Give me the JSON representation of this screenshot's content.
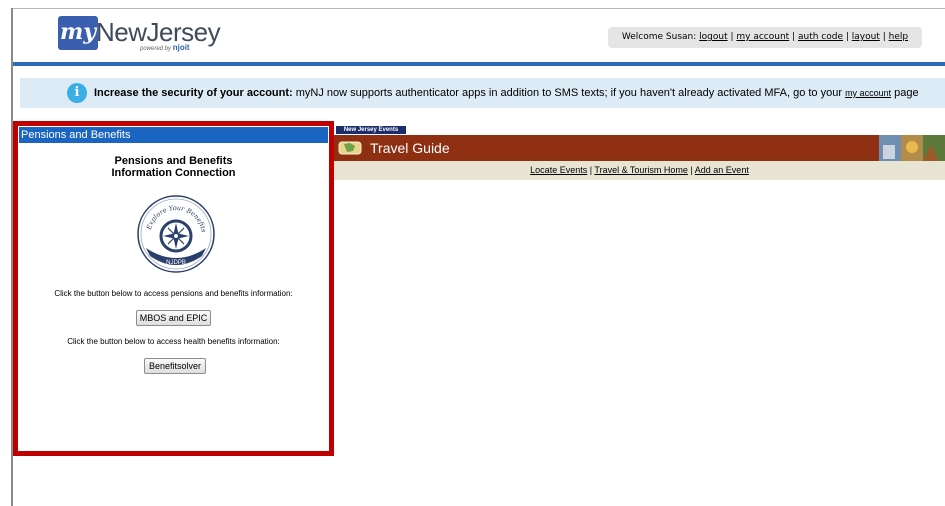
{
  "header": {
    "logo_my": "my",
    "logo_name": "NewJersey",
    "logo_powered": "powered by",
    "logo_powered_brand": "njoit",
    "welcome_text": "Welcome Susan:",
    "links": [
      "logout",
      "my account",
      "auth code",
      "layout",
      "help"
    ]
  },
  "alert": {
    "icon": "info-icon",
    "bold_text": "Increase the security of your account:",
    "text": " myNJ now supports authenticator apps in addition to SMS texts; if you haven't already activated MFA, go to your ",
    "link": "my account",
    "suffix": " page"
  },
  "pensions_panel": {
    "header": "Pensions and Benefits",
    "title_line1": "Pensions and Benefits",
    "title_line2": "Information Connection",
    "badge_top": "Explore Your Benefits",
    "badge_bottom": "NJDPB",
    "instruction1": "Click the button below to access pensions and benefits information:",
    "button1": "MBOS and EPIC",
    "instruction2": "Click the button below to access health benefits information:",
    "button2": "Benefitsolver"
  },
  "travel": {
    "tab": "New Jersey Events",
    "title": "Travel Guide",
    "links": [
      "Locate Events",
      "Travel & Tourism Home",
      "Add an Event"
    ]
  },
  "colors": {
    "panel_border": "#c00000",
    "panel_header": "#1a64c2",
    "travel_bar": "#8e2f12",
    "alert_bg": "#dcebf6",
    "blue_rule": "#2a6ab8"
  }
}
